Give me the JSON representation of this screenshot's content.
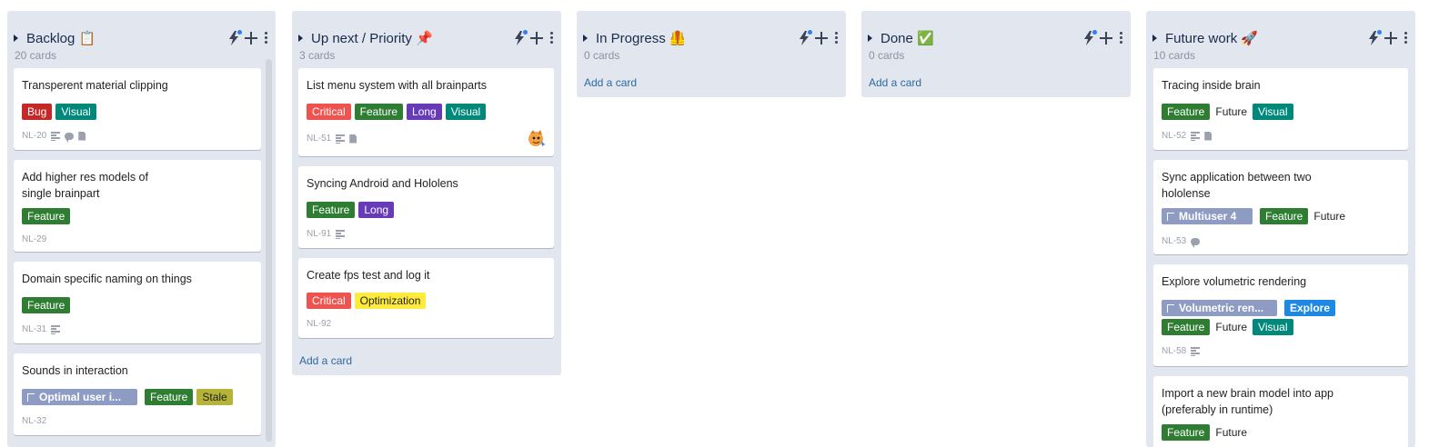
{
  "colors": {
    "column_bg": "#e2e6ee",
    "Bug": "#c62828",
    "Visual": "#00897b",
    "Feature": "#2e7d32",
    "Critical": "#ef5350",
    "Long": "#673ab7",
    "Optimization": "#ffeb3b",
    "Stale": "#b5b338",
    "Epic": "#8e9cc4",
    "Explore": "#1e88e5",
    "link": "#2d6aa3"
  },
  "icons": {
    "automation": "lightning-bolt-icon",
    "add": "plus-icon",
    "menu": "kebab-menu-icon",
    "collapse": "caret-right-icon",
    "description": "description-lines-icon",
    "comment": "speech-bubble-icon",
    "attachment": "file-icon"
  },
  "add_card_label": "Add a card",
  "columns": [
    {
      "title": "Backlog 📋",
      "count": "20 cards",
      "cards": [
        {
          "title": "Transperent material clipping",
          "tags": [
            {
              "label": "Bug",
              "color": "Bug"
            },
            {
              "label": "Visual",
              "color": "Visual"
            }
          ],
          "id": "NL-20"
        },
        {
          "title": "Add higher res models of single brainpart",
          "tags": [
            {
              "label": "Feature",
              "color": "Feature"
            }
          ],
          "id": "NL-29"
        },
        {
          "title": "Domain specific naming on things",
          "tags": [
            {
              "label": "Feature",
              "color": "Feature"
            }
          ],
          "id": "NL-31"
        },
        {
          "title": "Sounds in interaction",
          "tags": [
            {
              "label": "Optimal user i...",
              "color": "Epic"
            },
            {
              "label": "Feature",
              "color": "Feature"
            },
            {
              "label": "Stale",
              "color": "Stale"
            }
          ],
          "id": "NL-32"
        }
      ]
    },
    {
      "title": "Up next / Priority 📌",
      "count": "3 cards",
      "cards": [
        {
          "title": "List menu system with all brainparts",
          "tags": [
            {
              "label": "Critical",
              "color": "Critical"
            },
            {
              "label": "Feature",
              "color": "Feature"
            },
            {
              "label": "Long",
              "color": "Long"
            },
            {
              "label": "Visual",
              "color": "Visual"
            }
          ],
          "id": "NL-51"
        },
        {
          "title": "Syncing Android and Hololens",
          "tags": [
            {
              "label": "Feature",
              "color": "Feature"
            },
            {
              "label": "Long",
              "color": "Long"
            }
          ],
          "id": "NL-91"
        },
        {
          "title": "Create fps test and log it",
          "tags": [
            {
              "label": "Critical",
              "color": "Critical"
            },
            {
              "label": "Optimization",
              "color": "Optimization"
            }
          ],
          "id": "NL-92"
        }
      ]
    },
    {
      "title": "In Progress 🦺",
      "count": "0 cards",
      "cards": []
    },
    {
      "title": "Done ✅",
      "count": "0 cards",
      "cards": []
    },
    {
      "title": "Future work 🚀",
      "count": "10 cards",
      "cards": [
        {
          "title": "Tracing inside brain",
          "tags": [
            {
              "label": "Feature",
              "color": "Feature"
            },
            {
              "label": "Future",
              "color": "plain"
            },
            {
              "label": "Visual",
              "color": "Visual"
            }
          ],
          "id": "NL-52"
        },
        {
          "title": "Sync application between two hololense",
          "tags": [
            {
              "label": "Multiuser 4",
              "color": "Epic"
            },
            {
              "label": "Feature",
              "color": "Feature"
            },
            {
              "label": "Future",
              "color": "plain"
            }
          ],
          "id": "NL-53"
        },
        {
          "title": "Explore volumetric rendering",
          "tags": [
            {
              "label": "Volumetric ren...",
              "color": "Epic"
            },
            {
              "label": "Explore",
              "color": "Explore"
            }
          ],
          "tags2": [
            {
              "label": "Feature",
              "color": "Feature"
            },
            {
              "label": "Future",
              "color": "plain"
            },
            {
              "label": "Visual",
              "color": "Visual"
            }
          ],
          "id": "NL-58"
        },
        {
          "title": "Import a new brain model into app (preferably in runtime)",
          "tags": [
            {
              "label": "Feature",
              "color": "Feature"
            },
            {
              "label": "Future",
              "color": "plain"
            }
          ],
          "id": ""
        }
      ]
    }
  ]
}
